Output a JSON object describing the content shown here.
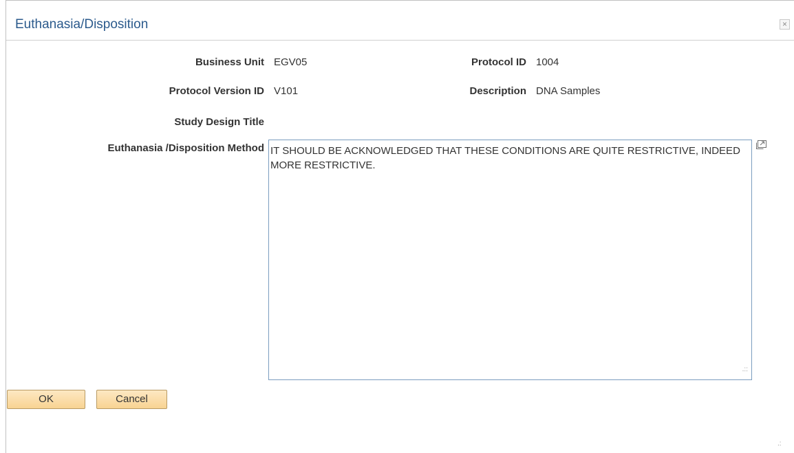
{
  "dialog": {
    "title": "Euthanasia/Disposition",
    "close_label": "×"
  },
  "fields": {
    "business_unit": {
      "label": "Business Unit",
      "value": "EGV05"
    },
    "protocol_id": {
      "label": "Protocol ID",
      "value": "1004"
    },
    "protocol_version_id": {
      "label": "Protocol Version ID",
      "value": "V101"
    },
    "description": {
      "label": "Description",
      "value": "DNA Samples"
    },
    "study_design_title": {
      "label": "Study Design Title",
      "value": ""
    },
    "method": {
      "label": "Euthanasia /Disposition Method",
      "value": "IT SHOULD BE ACKNOWLEDGED THAT THESE CONDITIONS ARE QUITE RESTRICTIVE, INDEED MORE RESTRICTIVE."
    }
  },
  "buttons": {
    "ok_label": "OK",
    "cancel_label": "Cancel"
  },
  "icons": {
    "close": "close-icon",
    "expand": "expand-icon",
    "resize": "resize-grip-icon"
  },
  "colors": {
    "title": "#2b5a8c",
    "button_bg": "#f8d392",
    "textarea_border": "#7a9cbf"
  }
}
